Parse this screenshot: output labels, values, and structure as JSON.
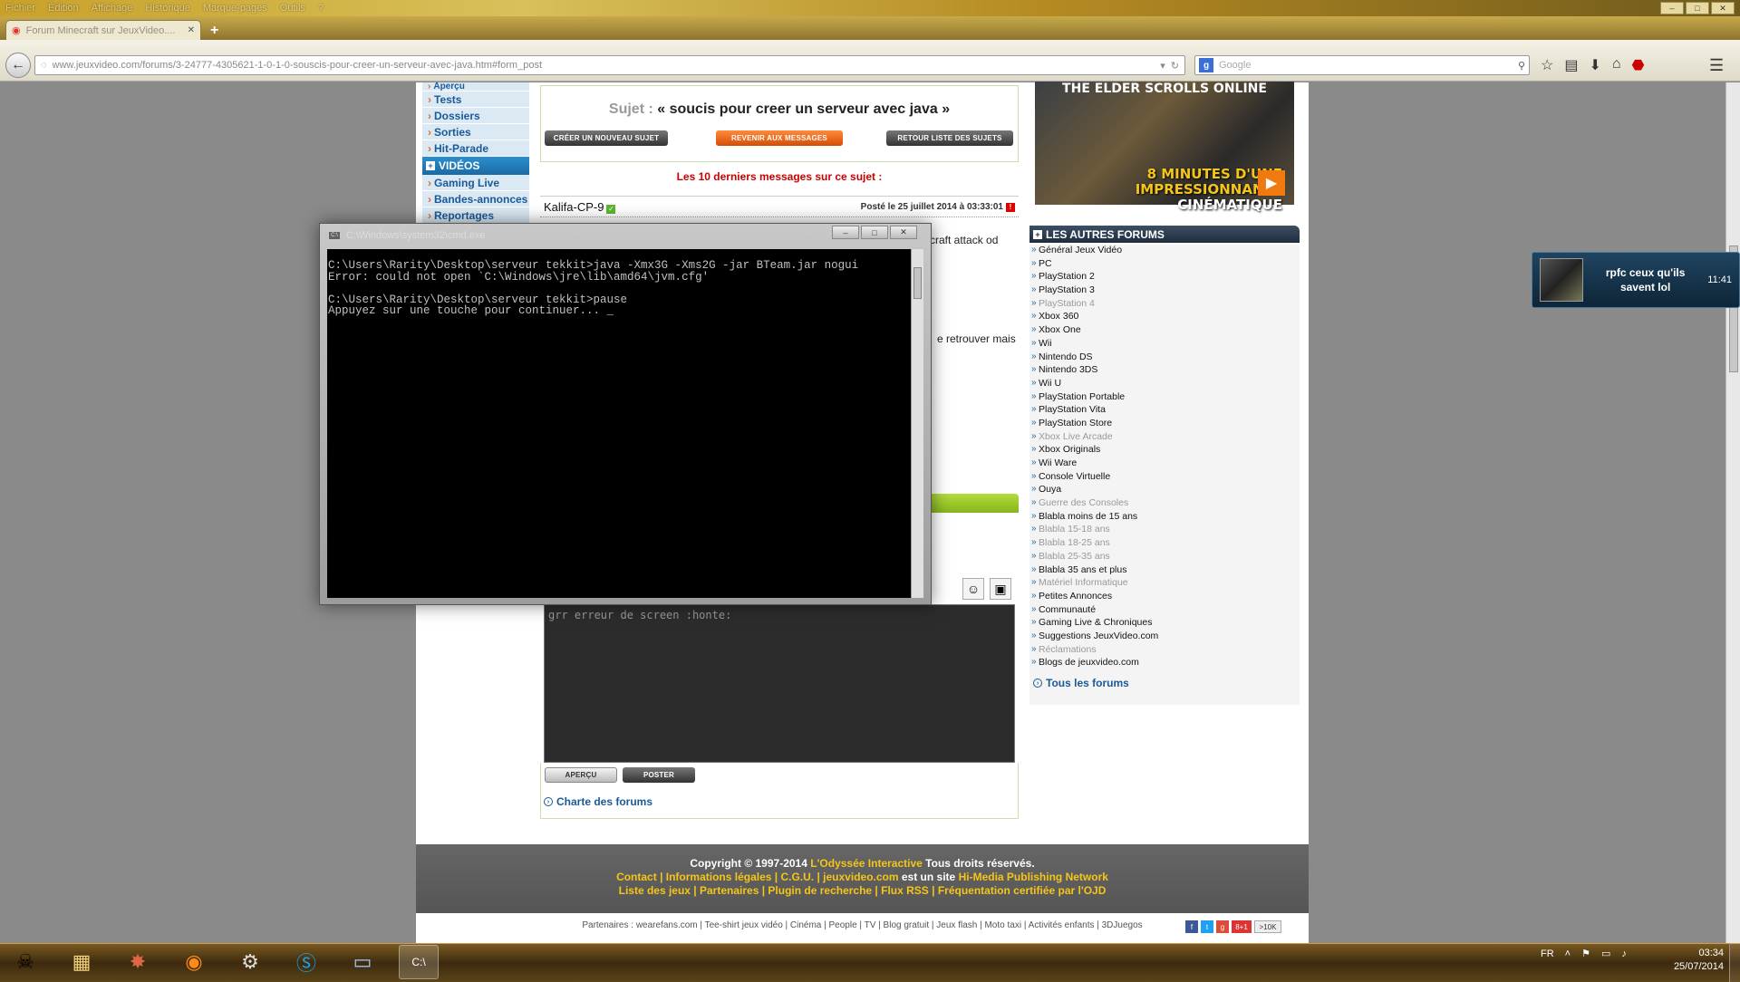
{
  "browser": {
    "menu": [
      "Fichier",
      "Édition",
      "Affichage",
      "Historique",
      "Marque-pages",
      "Outils",
      "?"
    ],
    "tab_title": "Forum Minecraft sur JeuxVideo....",
    "new_tab": "+",
    "url": "www.jeuxvideo.com/forums/3-24777-4305621-1-0-1-0-souscis-pour-creer-un-serveur-avec-java.htm#form_post",
    "search_placeholder": "Google",
    "win_buttons": [
      "–",
      "□",
      "✕"
    ]
  },
  "leftnav": {
    "items_top": [
      "Aperçu",
      "Tests",
      "Dossiers",
      "Sorties",
      "Hit-Parade"
    ],
    "videos_label": "VIDÉOS",
    "items_videos": [
      "Gaming Live",
      "Bandes-annonces",
      "Reportages"
    ]
  },
  "topic": {
    "label": "Sujet :",
    "title": "« soucis pour creer un serveur avec java »",
    "btn_new": "Créer un nouveau sujet",
    "btn_back": "Revenir aux messages",
    "btn_list": "Retour liste des sujets",
    "last_messages": "Les 10 derniers messages sur ce sujet :",
    "author": "Kalifa-CP-9",
    "posted": "Posté le 25 juillet 2014 à 03:33:01",
    "fragment1": "craft attack od",
    "fragment2": "e retrouver mais"
  },
  "reply": {
    "text": "grr erreur de screen  :honte:",
    "preview_label": "Aperçu",
    "post_label": "Poster",
    "charte": "Charte des forums"
  },
  "ad": {
    "title": "THE ELDER SCROLLS ONLINE",
    "line1": "8 MINUTES D'UNE",
    "line2": "IMPRESSIONNANTE",
    "line3": "CINÉMATIQUE"
  },
  "forums": {
    "heading": "LES AUTRES FORUMS",
    "items": [
      "Général Jeux Vidéo",
      "PC",
      "PlayStation 2",
      "PlayStation 3",
      "PlayStation 4",
      "Xbox 360",
      "Xbox One",
      "Wii",
      "Nintendo DS",
      "Nintendo 3DS",
      "Wii U",
      "PlayStation Portable",
      "PlayStation Vita",
      "PlayStation Store",
      "Xbox Live Arcade",
      "Xbox Originals",
      "Wii Ware",
      "Console Virtuelle",
      "Ouya",
      "Guerre des Consoles",
      "Blabla moins de 15 ans",
      "Blabla 15-18 ans",
      "Blabla 18-25 ans",
      "Blabla 25-35 ans",
      "Blabla 35 ans et plus",
      "Matériel Informatique",
      "Petites Annonces",
      "Communauté",
      "Gaming Live & Chroniques",
      "Suggestions JeuxVideo.com",
      "Réclamations",
      "Blogs de jeuxvideo.com"
    ],
    "dim": [
      false,
      false,
      false,
      false,
      true,
      false,
      false,
      false,
      false,
      false,
      false,
      false,
      false,
      false,
      true,
      false,
      false,
      false,
      false,
      true,
      false,
      true,
      true,
      true,
      false,
      true,
      false,
      false,
      false,
      false,
      true,
      false
    ],
    "all": "Tous les forums"
  },
  "footer": {
    "copyright_pre": "Copyright © 1997-2014",
    "copyright_company": "L'Odyssée Interactive",
    "copyright_post": "Tous droits réservés.",
    "line2_links": "Contact | Informations légales | C.G.U. | jeuxvideo.com",
    "line2_mid": "est un site",
    "line2_end": "Hi-Media Publishing Network",
    "line3": "Liste des jeux | Partenaires | Plugin de recherche | Flux RSS | Fréquentation certifiée par l'OJD",
    "partners": "Partenaires : wearefans.com | Tee-shirt jeux vidéo | Cinéma | People | TV | Blog gratuit | Jeux flash | Moto taxi | Activités enfants | 3DJuegos",
    "counter": ">10K",
    "gplus": "8+1"
  },
  "cmd": {
    "title": "C:\\Windows\\system32\\cmd.exe",
    "output": "C:\\Users\\Rarity\\Desktop\\serveur tekkit>java -Xmx3G -Xms2G -jar BTeam.jar nogui\nError: could not open `C:\\Windows\\jre\\lib\\amd64\\jvm.cfg'\n\nC:\\Users\\Rarity\\Desktop\\serveur tekkit>pause\nAppuyez sur une touche pour continuer... _"
  },
  "notification": {
    "message": "rpfc ceux qu'ils savent lol",
    "time": "11:41"
  },
  "taskbar": {
    "lang": "FR",
    "time": "03:34",
    "date": "25/07/2014"
  }
}
